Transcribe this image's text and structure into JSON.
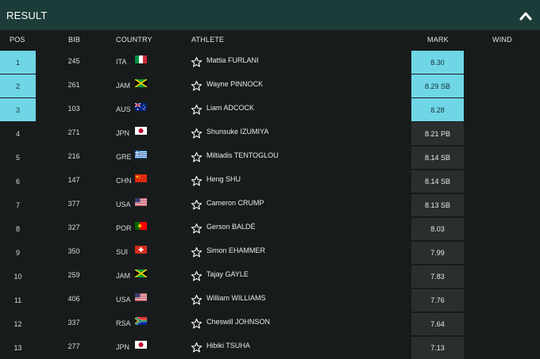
{
  "header": {
    "title": "RESULT",
    "toggle_icon": "chevron-up-icon"
  },
  "columns": {
    "pos": "POS",
    "bib": "BIB",
    "country": "COUNTRY",
    "athlete": "ATHLETE",
    "mark": "MARK",
    "wind": "WIND"
  },
  "colors": {
    "header_bg": "#1c3c39",
    "page_bg": "#181b1c",
    "medal_highlight": "#6fd6e6",
    "mark_cell_bg": "#2b2e2f"
  },
  "rows": [
    {
      "pos": "1",
      "bib": "245",
      "country": "ITA",
      "athlete": "Mattia FURLANI",
      "mark": "8.30",
      "medal": true,
      "flag": "ITA"
    },
    {
      "pos": "2",
      "bib": "261",
      "country": "JAM",
      "athlete": "Wayne PINNOCK",
      "mark": "8.29 SB",
      "medal": true,
      "flag": "JAM"
    },
    {
      "pos": "3",
      "bib": "103",
      "country": "AUS",
      "athlete": "Liam ADCOCK",
      "mark": "8.28",
      "medal": true,
      "flag": "AUS"
    },
    {
      "pos": "4",
      "bib": "271",
      "country": "JPN",
      "athlete": "Shunsuke IZUMIYA",
      "mark": "8.21 PB",
      "medal": false,
      "flag": "JPN"
    },
    {
      "pos": "5",
      "bib": "216",
      "country": "GRE",
      "athlete": "Miltiadis TENTOGLOU",
      "mark": "8.14 SB",
      "medal": false,
      "flag": "GRE"
    },
    {
      "pos": "6",
      "bib": "147",
      "country": "CHN",
      "athlete": "Heng SHU",
      "mark": "8.14 SB",
      "medal": false,
      "flag": "CHN"
    },
    {
      "pos": "7",
      "bib": "377",
      "country": "USA",
      "athlete": "Cameron CRUMP",
      "mark": "8.13 SB",
      "medal": false,
      "flag": "USA"
    },
    {
      "pos": "8",
      "bib": "327",
      "country": "POR",
      "athlete": "Gerson BALDÉ",
      "mark": "8.03",
      "medal": false,
      "flag": "POR"
    },
    {
      "pos": "9",
      "bib": "350",
      "country": "SUI",
      "athlete": "Simon EHAMMER",
      "mark": "7.99",
      "medal": false,
      "flag": "SUI"
    },
    {
      "pos": "10",
      "bib": "259",
      "country": "JAM",
      "athlete": "Tajay GAYLE",
      "mark": "7.83",
      "medal": false,
      "flag": "JAM"
    },
    {
      "pos": "11",
      "bib": "406",
      "country": "USA",
      "athlete": "William WILLIAMS",
      "mark": "7.76",
      "medal": false,
      "flag": "USA"
    },
    {
      "pos": "12",
      "bib": "337",
      "country": "RSA",
      "athlete": "Cheswill JOHNSON",
      "mark": "7.64",
      "medal": false,
      "flag": "RSA"
    },
    {
      "pos": "13",
      "bib": "277",
      "country": "JPN",
      "athlete": "Hibiki TSUHA",
      "mark": "7.13",
      "medal": false,
      "flag": "JPN"
    }
  ]
}
